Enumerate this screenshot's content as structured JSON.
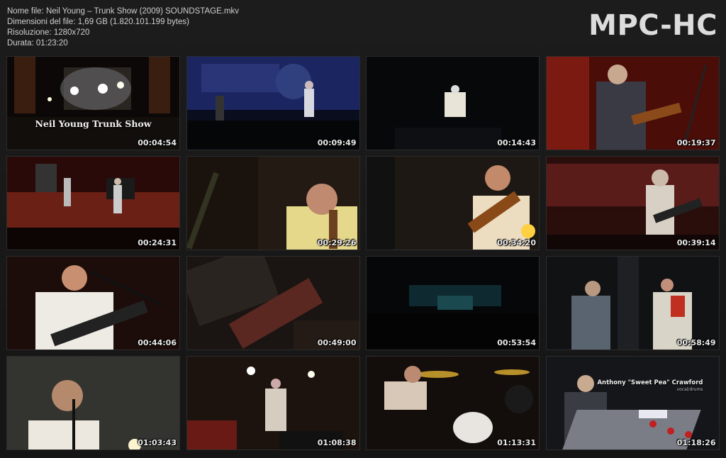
{
  "file_info": {
    "name": "Nome file: Neil Young – Trunk Show (2009) SOUNDSTAGE.mkv",
    "size": "Dimensioni del file: 1,69 GB (1.820.101.199 bytes)",
    "resolution": "Risoluzione: 1280x720",
    "duration": "Durata: 01:23:20"
  },
  "logo": "MPC-HC",
  "thumbnails": [
    {
      "time": "00:04:54",
      "overlay": "Neil Young Trunk Show"
    },
    {
      "time": "00:09:49"
    },
    {
      "time": "00:14:43"
    },
    {
      "time": "00:19:37"
    },
    {
      "time": "00:24:31"
    },
    {
      "time": "00:29:26"
    },
    {
      "time": "00:34:20"
    },
    {
      "time": "00:39:14"
    },
    {
      "time": "00:44:06"
    },
    {
      "time": "00:49:00"
    },
    {
      "time": "00:53:54"
    },
    {
      "time": "00:58:49"
    },
    {
      "time": "01:03:43"
    },
    {
      "time": "01:08:38"
    },
    {
      "time": "01:13:31"
    },
    {
      "time": "01:18:26",
      "credit": "Anthony \"Sweet Pea\" Crawford",
      "credit_sub": "vocal/drums"
    }
  ]
}
